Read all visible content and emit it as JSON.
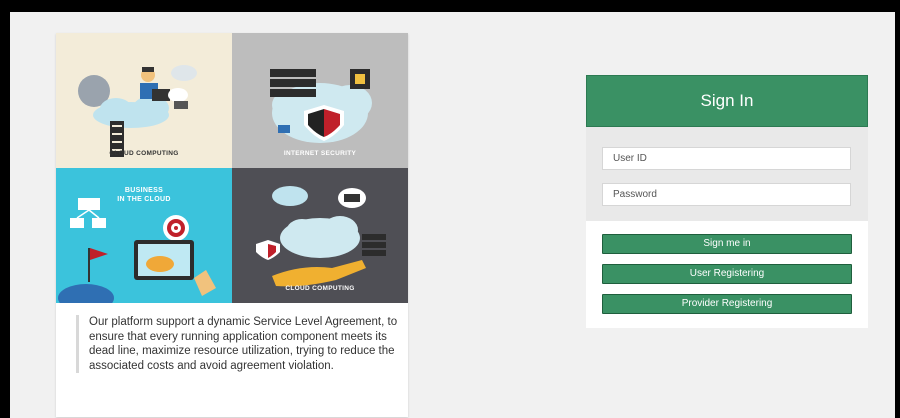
{
  "illustration": {
    "tiles": [
      {
        "caption": "CLOUD COMPUTING"
      },
      {
        "caption": "INTERNET SECURITY"
      },
      {
        "caption": "BUSINESS\nIN THE CLOUD"
      },
      {
        "caption": "CLOUD COMPUTING"
      }
    ],
    "description": "Our platform support a dynamic Service Level Agreement, to ensure that every running application component meets its dead line, maximize resource utilization, trying to reduce the associated costs and avoid agreement violation."
  },
  "login": {
    "title": "Sign In",
    "user_id_placeholder": "User ID",
    "password_placeholder": "Password",
    "sign_in_label": "Sign me in",
    "user_register_label": "User Registering",
    "provider_register_label": "Provider Registering"
  },
  "colors": {
    "accent_green": "#3a9164",
    "tile_cream": "#f3ecd9",
    "tile_gray": "#bdbdbd",
    "tile_cyan": "#3bc3dc",
    "tile_dark": "#4f4f55"
  }
}
